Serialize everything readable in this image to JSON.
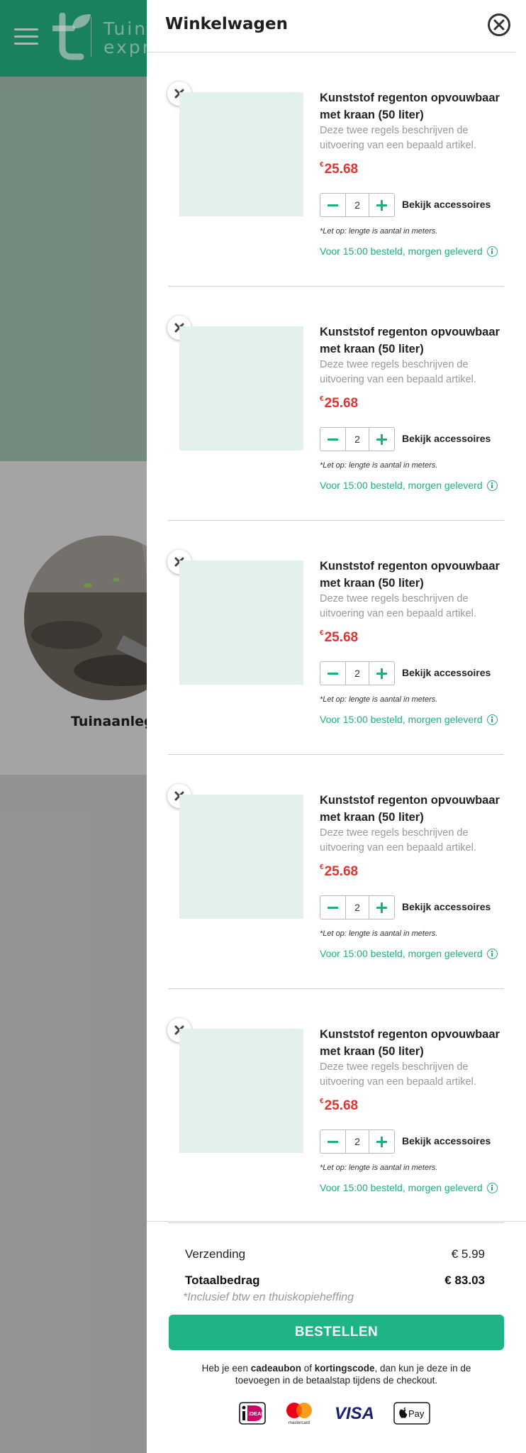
{
  "background": {
    "logo_text_line1": "Tuin",
    "logo_text_line2": "expr",
    "category_label": "Tuinaanleg"
  },
  "cart": {
    "title": "Winkelwagen",
    "items": [
      {
        "name": "Kunststof regenton opvouwbaar met kraan (50 liter)",
        "description": "Deze twee regels beschrijven de uitvoering van een bepaald artikel.",
        "currency": "€",
        "price": "25.68",
        "quantity": "2",
        "accessories_label": "Bekijk accessoires",
        "note": "*Let op: lengte is aantal in meters.",
        "delivery": "Voor 15:00 besteld, morgen geleverd"
      },
      {
        "name": "Kunststof regenton opvouwbaar met kraan (50 liter)",
        "description": "Deze twee regels beschrijven de uitvoering van een bepaald artikel.",
        "currency": "€",
        "price": "25.68",
        "quantity": "2",
        "accessories_label": "Bekijk accessoires",
        "note": "*Let op: lengte is aantal in meters.",
        "delivery": "Voor 15:00 besteld, morgen geleverd"
      },
      {
        "name": "Kunststof regenton opvouwbaar met kraan (50 liter)",
        "description": "Deze twee regels beschrijven de uitvoering van een bepaald artikel.",
        "currency": "€",
        "price": "25.68",
        "quantity": "2",
        "accessories_label": "Bekijk accessoires",
        "note": "*Let op: lengte is aantal in meters.",
        "delivery": "Voor 15:00 besteld, morgen geleverd"
      },
      {
        "name": "Kunststof regenton opvouwbaar met kraan (50 liter)",
        "description": "Deze twee regels beschrijven de uitvoering van een bepaald artikel.",
        "currency": "€",
        "price": "25.68",
        "quantity": "2",
        "accessories_label": "Bekijk accessoires",
        "note": "*Let op: lengte is aantal in meters.",
        "delivery": "Voor 15:00 besteld, morgen geleverd"
      },
      {
        "name": "Kunststof regenton opvouwbaar met kraan (50 liter)",
        "description": "Deze twee regels beschrijven de uitvoering van een bepaald artikel.",
        "currency": "€",
        "price": "25.68",
        "quantity": "2",
        "accessories_label": "Bekijk accessoires",
        "note": "*Let op: lengte is aantal in meters.",
        "delivery": "Voor 15:00 besteld, morgen geleverd"
      }
    ],
    "shipping_label": "Verzending",
    "shipping_value": "€ 5.99",
    "total_label": "Totaalbedrag",
    "total_value": "€ 83.03",
    "vat_note": "*Inclusief btw en thuiskopieheffing",
    "order_button": "BESTELLEN",
    "gift_note": {
      "part1": "Heb je een ",
      "bold1": "cadeaubon",
      "part2": " of ",
      "bold2": "kortingscode",
      "part3": ", dan kun je deze in de toevoegen in de betaalstap tijdens de checkout."
    },
    "payment_methods": [
      "iDEAL",
      "mastercard",
      "VISA",
      "Pay"
    ]
  },
  "colors": {
    "brand_green": "#1fae83",
    "price_red": "#e8312e",
    "header_green": "#1f9e74"
  }
}
